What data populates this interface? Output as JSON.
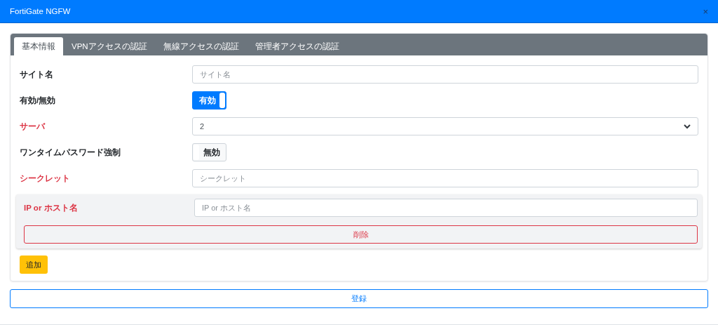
{
  "window": {
    "title": "FortiGate NGFW",
    "close": "×"
  },
  "tabs": [
    {
      "label": "基本情報",
      "selected": true
    },
    {
      "label": "VPNアクセスの認証",
      "selected": false
    },
    {
      "label": "無線アクセスの認証",
      "selected": false
    },
    {
      "label": "管理者アクセスの認証",
      "selected": false
    }
  ],
  "fields": [
    {
      "kind": "text",
      "label": "サイト名",
      "required": false,
      "placeholder": "サイト名"
    },
    {
      "kind": "toggle",
      "label": "有効/無効",
      "required": false,
      "on": true,
      "value": "有効"
    },
    {
      "kind": "select",
      "label": "サーバ",
      "required": true,
      "value": "2"
    },
    {
      "kind": "toggle",
      "label": "ワンタイムパスワード強制",
      "required": false,
      "on": false,
      "value": "無効"
    },
    {
      "kind": "text",
      "label": "シークレット",
      "required": true,
      "placeholder": "シークレット"
    }
  ],
  "hosts": [
    {
      "label": "IP or ホスト名",
      "required": true,
      "placeholder": "IP or ホスト名",
      "delete_button": "削除"
    }
  ],
  "add_button": "追加",
  "submit_button": "登録"
}
